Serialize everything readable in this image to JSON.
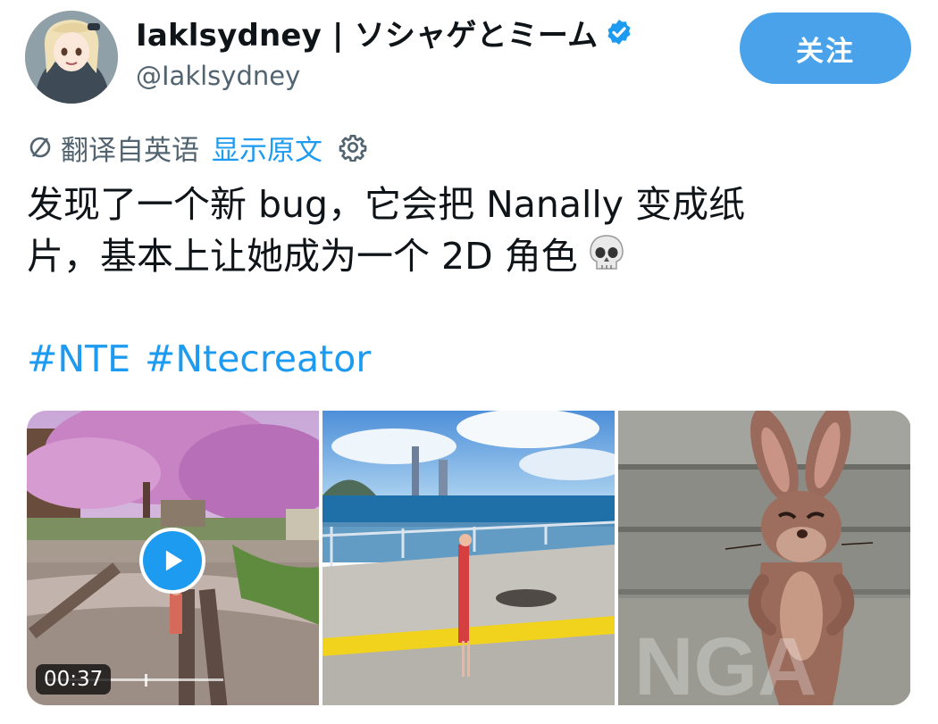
{
  "author": {
    "display_name": "Iaklsydney | ソシャゲとミーム",
    "handle": "@Iaklsydney",
    "verified": true,
    "avatar": "anime-girl-avatar"
  },
  "follow_button": {
    "label": "关注",
    "color": "#4aa3ea"
  },
  "translation": {
    "label": "翻译自英语",
    "show_original": "显示原文",
    "icon": "translate-icon",
    "settings_icon": "gear-icon"
  },
  "tweet": {
    "line1": "发现了一个新 bug，它会把 Nanally 变成纸",
    "line2": "片，基本上让她成为一个 2D 角色",
    "emoji": "skull"
  },
  "hashtags": [
    "#NTE",
    "#Ntecreator"
  ],
  "media": {
    "video_duration": "00:37",
    "watermark": "NGA",
    "items": [
      "cherry-blossom-railway-video",
      "seaside-promenade-screenshot",
      "cartoon-mouse-meme"
    ]
  },
  "colors": {
    "link": "#1d9bf0",
    "text": "#0f1419",
    "secondary": "#536471"
  }
}
